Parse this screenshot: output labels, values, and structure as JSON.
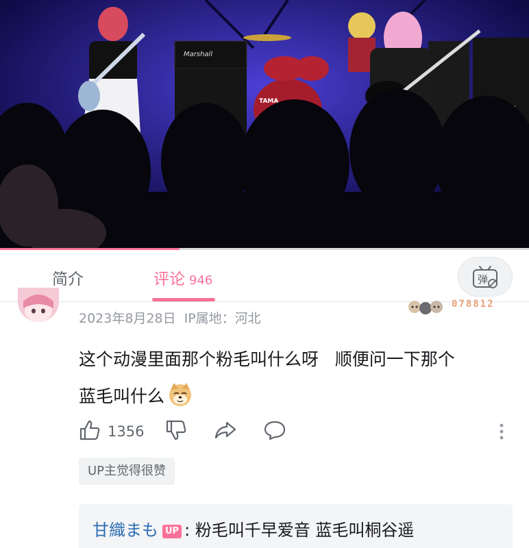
{
  "video": {
    "progress_percent": 34,
    "amp_brand": "Marshall",
    "drum_brand": "TAMA"
  },
  "tabs": {
    "intro_label": "简介",
    "comments_label": "评论",
    "comments_count": "946",
    "danmaku_label": "弹"
  },
  "comment": {
    "date": "2023年8月28日",
    "ip_location": "IP属地：河北",
    "fan_badge_number": "078812",
    "text_line1": "这个动漫里面那个粉毛叫什么呀   顺便问一下那个",
    "text_line2": "蓝毛叫什么",
    "emoji_name": "doge-emoji",
    "like_count": "1356",
    "up_liked_label": "UP主觉得很赞"
  },
  "reply": {
    "username": "甘織まも",
    "up_tag": "UP",
    "text": ": 粉毛叫千早爱音 蓝毛叫桐谷遥"
  },
  "colors": {
    "accent": "#fb7299",
    "link": "#2c6db3",
    "secondary_text": "#9499a0"
  }
}
